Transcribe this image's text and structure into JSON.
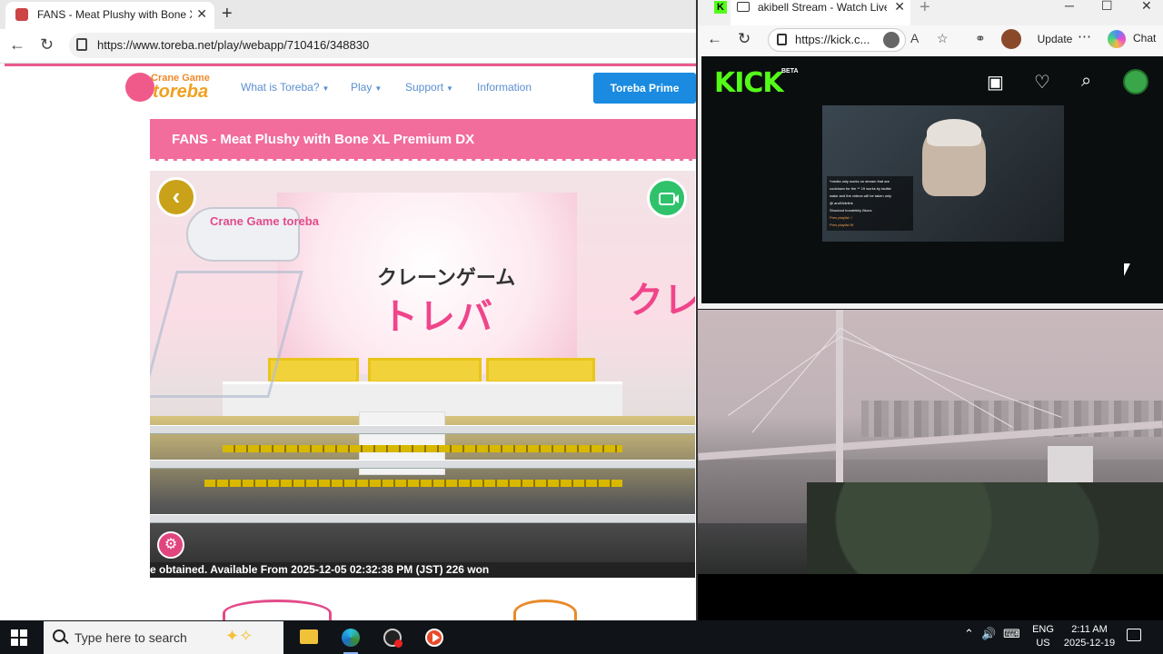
{
  "left_browser": {
    "tab_title": "FANS - Meat Plushy with Bone XL",
    "url": "https://www.toreba.net/play/webapp/710416/348830",
    "close_glyph": "✕",
    "newtab_glyph": "+",
    "back_glyph": "←",
    "reload_glyph": "↻"
  },
  "site": {
    "logo_top": "Crane Game",
    "logo_bottom": "toreba",
    "nav": [
      {
        "label": "What is Toreba?",
        "has_dropdown": true
      },
      {
        "label": "Play",
        "has_dropdown": true
      },
      {
        "label": "Support",
        "has_dropdown": true
      },
      {
        "label": "Information",
        "has_dropdown": false
      }
    ],
    "caret_glyph": "▼",
    "prime_button": "Toreba Prime",
    "prize_title": "FANS - Meat Plushy with Bone XL Premium DX",
    "game": {
      "claw_label": "Crane Game toreba",
      "backboard_line1": "クレーンゲーム",
      "backboard_line2": "トレバ",
      "side_text": "クレー",
      "back_glyph": "‹",
      "settings_glyph": "⚙",
      "ticker": "e obtained. Available From 2025-12-05 02:32:38 PM (JST) 226 won"
    },
    "colors": {
      "brand_pink": "#f26d9c",
      "primary_blue": "#1a8be0",
      "logo_orange": "#f0a020"
    }
  },
  "right_browser": {
    "tab_title": "akibell Stream - Watch Live o",
    "url": "https://kick.c...",
    "update_label": "Update",
    "more_glyph": "⋯",
    "chat_label": "Chat",
    "close_glyph": "✕",
    "newtab_glyph": "+",
    "back_glyph": "←",
    "reload_glyph": "↻",
    "window_controls": [
      "─",
      "☐",
      "✕"
    ],
    "toolbar_icons": [
      "read-aloud-icon",
      "favorite-star-icon",
      "extensions-icon"
    ]
  },
  "kick": {
    "logo": "KICK",
    "beta": "BETA",
    "icons": [
      "following-icon",
      "heart-icon",
      "search-icon",
      "avatar"
    ],
    "icon_glyphs": {
      "following": "▣",
      "heart": "♡",
      "search": "⌕"
    },
    "overlay_lines": [
      "*media only works on stream that are",
      "cooldown for the ** 19 works by tadlist",
      "wake and the videos will be taken only",
      "@ andVidelink",
      "Shoutout hondetkily Bkurs",
      "Pres playlist  ✓",
      "Pres playlist  W"
    ],
    "accent": "#53fc18"
  },
  "taskbar": {
    "search_placeholder": "Type here to search",
    "apps": [
      "file-explorer",
      "edge",
      "obs",
      "media-player"
    ],
    "tray": {
      "chevron": "⌃",
      "volume": "🔊",
      "keyboard": "⌨",
      "lang_line1": "ENG",
      "lang_line2": "US",
      "time": "2:11 AM",
      "date": "2025-12-19"
    }
  }
}
